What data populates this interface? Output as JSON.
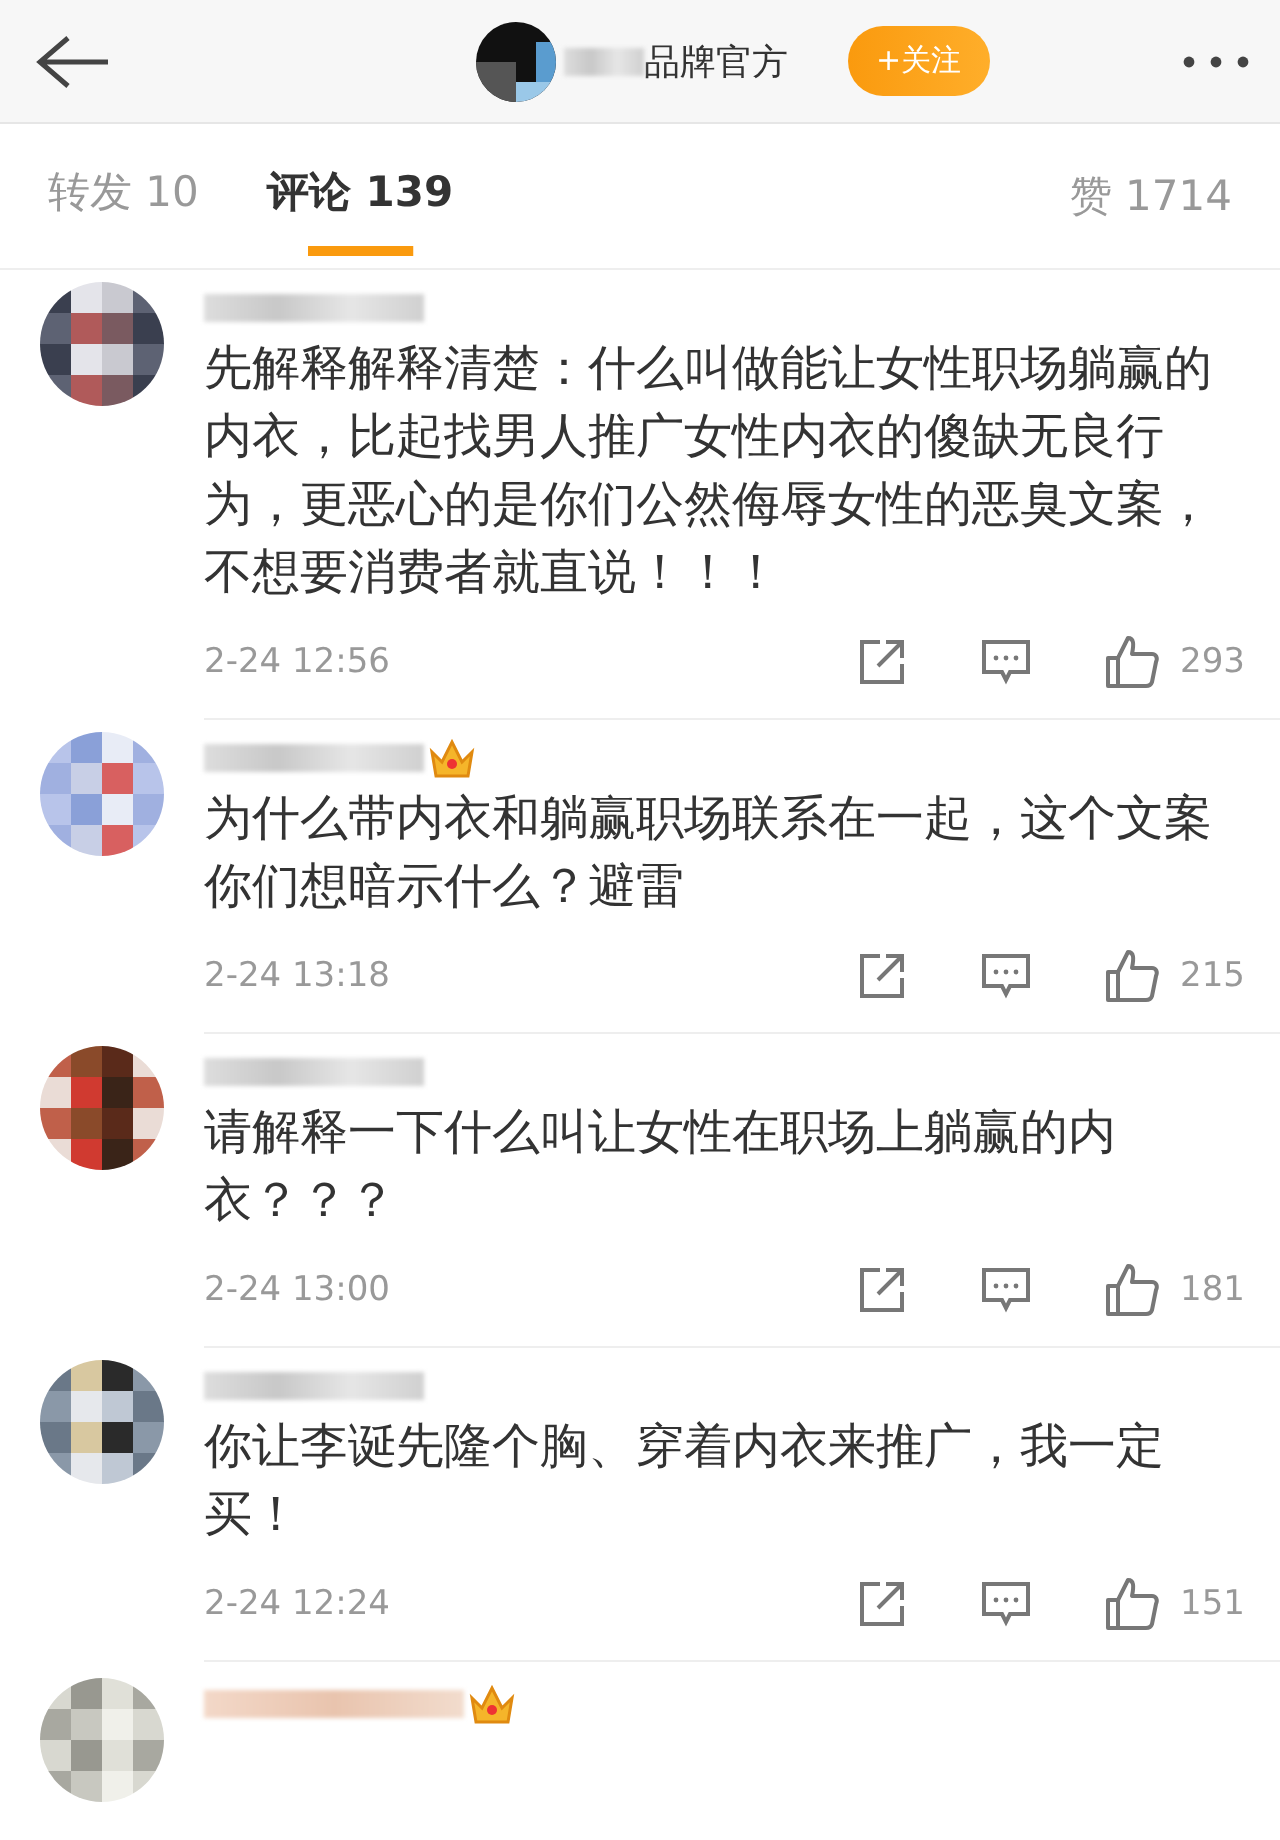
{
  "header": {
    "title": "品牌官方",
    "follow_button": "+关注"
  },
  "tabs": [
    {
      "label": "转发 10",
      "selected": false
    },
    {
      "label": "评论 139",
      "selected": true
    }
  ],
  "likes_total": "赞 1714",
  "comments": [
    {
      "crown": false,
      "text": "先解释解释清楚：什么叫做能让女性职场躺赢的内衣，比起找男人推广女性内衣的傻缺无良行为，更恶心的是你们公然侮辱女性的恶臭文案，不想要消费者就直说！！！",
      "time": "2-24 12:56",
      "likes": "293"
    },
    {
      "crown": true,
      "text": "为什么带内衣和躺赢职场联系在一起，这个文案你们想暗示什么？避雷",
      "time": "2-24 13:18",
      "likes": "215"
    },
    {
      "crown": false,
      "text": "请解释一下什么叫让女性在职场上躺赢的内衣？？？",
      "time": "2-24 13:00",
      "likes": "181"
    },
    {
      "crown": false,
      "text": "你让李诞先隆个胸、穿着内衣来推广，我一定买！",
      "time": "2-24 12:24",
      "likes": "151"
    }
  ],
  "partial_comment": {
    "crown": true
  }
}
